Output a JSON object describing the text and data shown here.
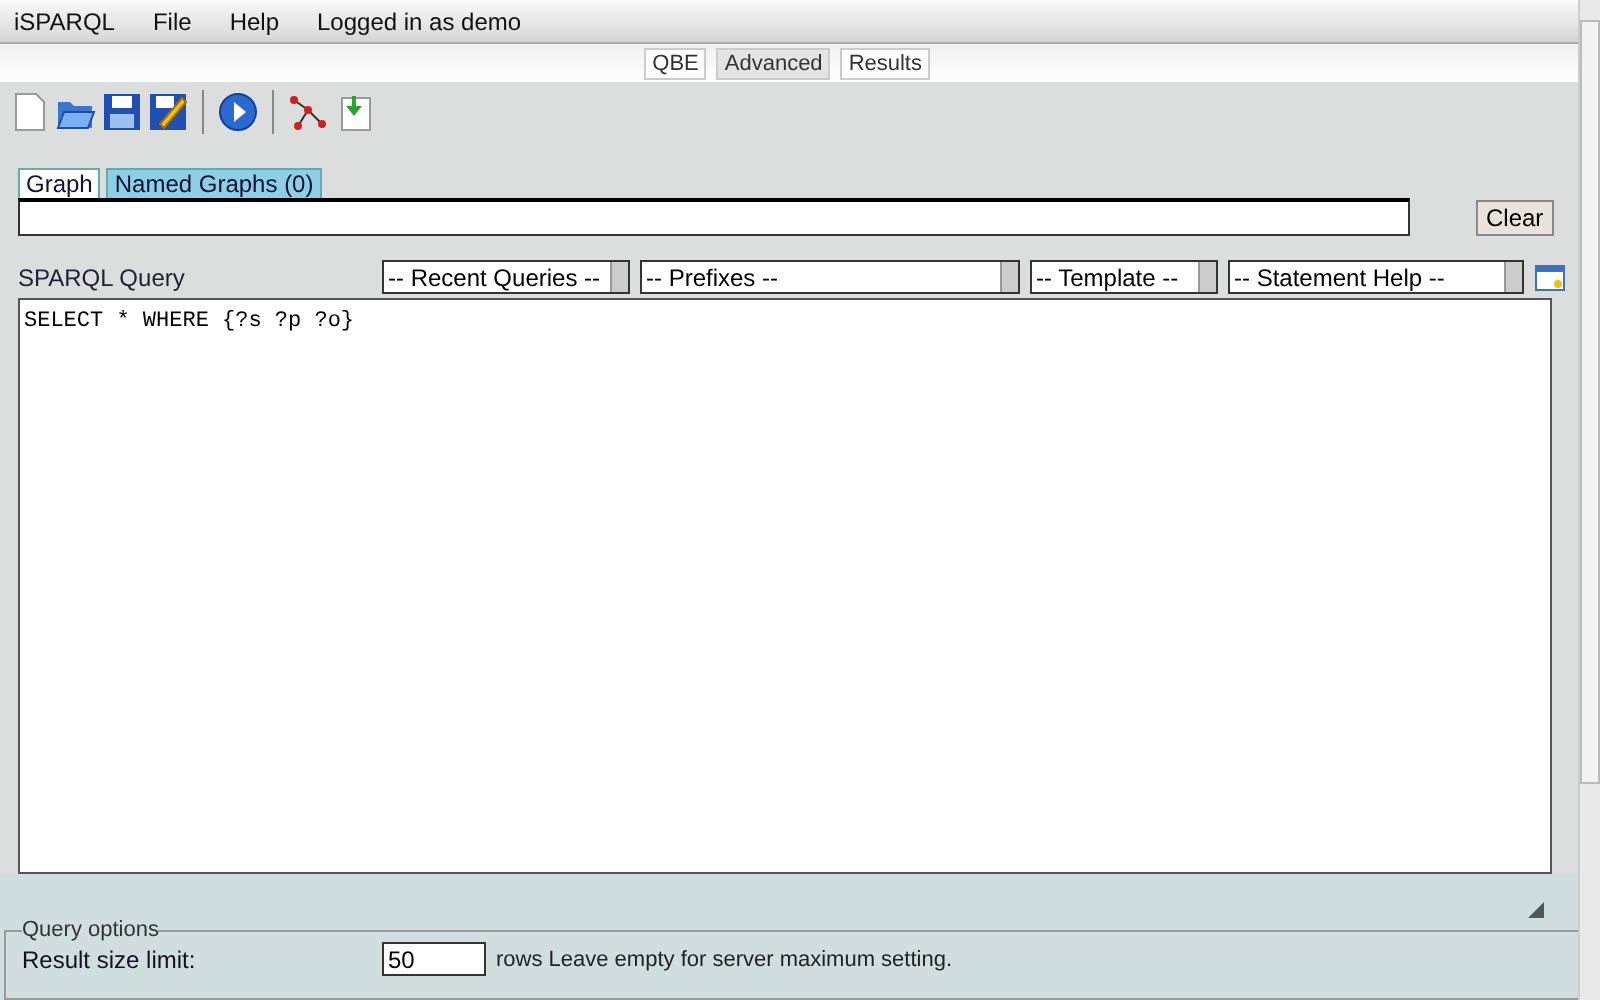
{
  "menu": [
    "iSPARQL",
    "File",
    "Help",
    "Logged in as demo"
  ],
  "view_tabs": [
    {
      "label": "QBE",
      "selected": false
    },
    {
      "label": "Advanced",
      "selected": true
    },
    {
      "label": "Results",
      "selected": false
    }
  ],
  "graph_tabs": [
    {
      "label": "Graph",
      "selected": true
    },
    {
      "label": "Named Graphs (0)",
      "selected": false
    }
  ],
  "clear_button": "Clear",
  "query": {
    "label": "SPARQL Query",
    "selects": [
      "-- Recent Queries --",
      "-- Prefixes --",
      "-- Template --",
      "-- Statement Help --"
    ],
    "text": "SELECT * WHERE {?s ?p ?o}"
  },
  "query_options": {
    "legend": "Query options",
    "label": "Result size limit:",
    "value": "50",
    "hint": "rows Leave empty for server maximum setting."
  }
}
